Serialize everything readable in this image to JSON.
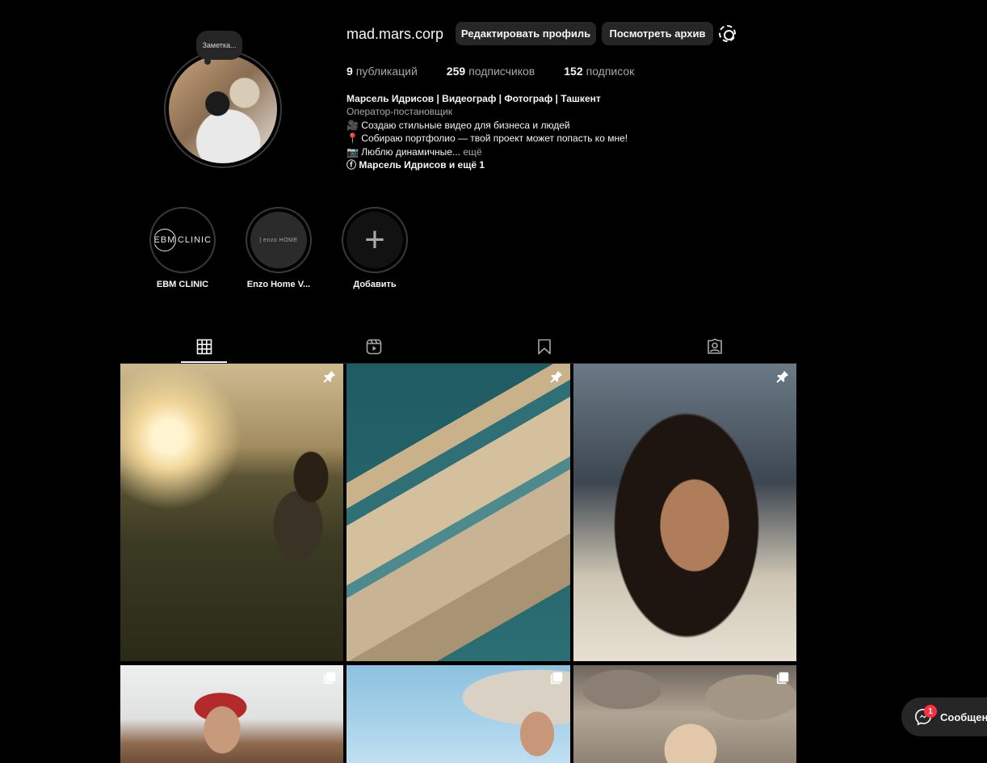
{
  "profile": {
    "note": "Заметка...",
    "username": "mad.mars.corp",
    "edit_button": "Редактировать профиль",
    "archive_button": "Посмотреть архив",
    "stats": {
      "posts_count": "9",
      "posts_label": "публикаций",
      "followers_count": "259",
      "followers_label": "подписчиков",
      "following_count": "152",
      "following_label": "подписок"
    },
    "bio": {
      "name": "Марсель Идрисов | Видеограф | Фотограф | Ташкент",
      "category": "Оператор-постановщик",
      "line1": "🎥 Создаю стильные видео для бизнеса и людей",
      "line2": "📍 Собираю портфолио — твой проект может попасть ко мне!",
      "line3": "📷 Люблю динамичные...",
      "more": "ещё",
      "links": "ⓕ Марсель Идрисов и ещё 1"
    }
  },
  "highlights": [
    {
      "label": "EBM CLINIC",
      "cover_text": "CLINIC",
      "cover_mark": "EBM"
    },
    {
      "label": "Enzo Home V...",
      "cover_text": "| enzo HOME"
    },
    {
      "label": "Добавить",
      "cover_text": "+"
    }
  ],
  "tabs": {
    "icons": [
      "grid-icon",
      "reels-icon",
      "bookmark-icon",
      "tagged-icon"
    ],
    "active": "grid"
  },
  "posts": [
    {
      "badge": "pin-icon"
    },
    {
      "badge": "pin-icon"
    },
    {
      "badge": "pin-icon"
    },
    {
      "badge": "carousel-icon"
    },
    {
      "badge": "carousel-icon"
    },
    {
      "badge": "carousel-icon"
    }
  ],
  "messages": {
    "badge": "1",
    "label": "Сообщения"
  },
  "colors": {
    "background": "#000000",
    "button_bg": "#262626",
    "muted_text": "#a8a8a8",
    "badge_red": "#ff3040"
  }
}
